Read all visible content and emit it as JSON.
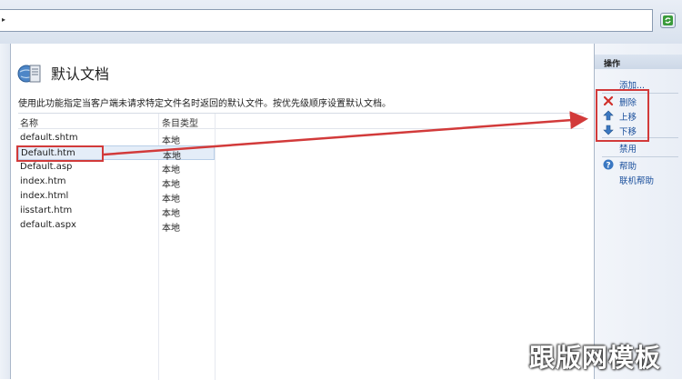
{
  "page": {
    "title": "默认文档",
    "description": "使用此功能指定当客户端未请求特定文件名时返回的默认文件。按优先级顺序设置默认文档。"
  },
  "list": {
    "columns": [
      "名称",
      "条目类型"
    ],
    "rows": [
      {
        "name": "default.shtm",
        "type": "本地"
      },
      {
        "name": "Default.htm",
        "type": "本地"
      },
      {
        "name": "Default.asp",
        "type": "本地"
      },
      {
        "name": "index.htm",
        "type": "本地"
      },
      {
        "name": "index.html",
        "type": "本地"
      },
      {
        "name": "iisstart.htm",
        "type": "本地"
      },
      {
        "name": "default.aspx",
        "type": "本地"
      }
    ],
    "selected_index": 1
  },
  "actions": {
    "title": "操作",
    "add": "添加...",
    "remove": "删除",
    "move_up": "上移",
    "move_down": "下移",
    "disable": "禁用",
    "help": "帮助",
    "online_help": "联机帮助"
  },
  "icons": {
    "page": "server-document-icon",
    "remove": "red-x-icon",
    "up": "blue-up-arrow-icon",
    "down": "blue-down-arrow-icon",
    "help": "help-question-icon",
    "refresh": "refresh-icon"
  },
  "colors": {
    "link": "#1a4f9c",
    "annotation": "#d23a3a",
    "selection": "#e4edf8"
  },
  "watermark": "跟版网模板"
}
